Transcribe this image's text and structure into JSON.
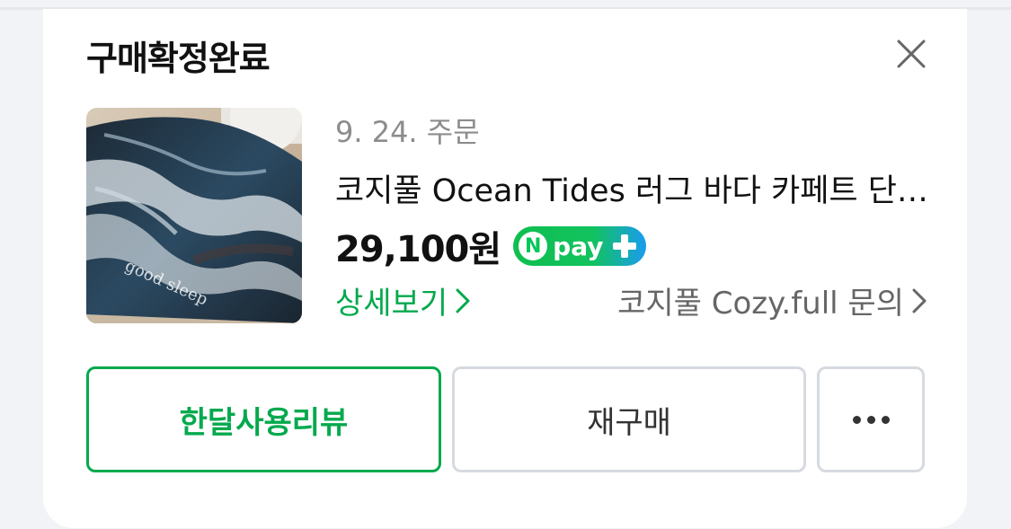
{
  "header": {
    "title": "구매확정완료"
  },
  "order": {
    "date_label": "9. 24. 주문",
    "product_name": "코지풀 Ocean Tides 러그 바다 카페트 단모 소형",
    "price": "29,100원",
    "npay": {
      "n_letter": "N",
      "text": "pay"
    },
    "detail_link": "상세보기",
    "inquiry_link": "코지풀 Cozy.full 문의",
    "thumbnail_caption": "good sleep"
  },
  "actions": {
    "review_label": "한달사용리뷰",
    "rebuy_label": "재구매"
  },
  "colors": {
    "accent_green": "#03a94d",
    "npay_green": "#03c75a",
    "npay_blue": "#1a9cf0",
    "border_gray": "#d6dae0"
  },
  "icons": {
    "close": "close-icon",
    "chevron": "chevron-right-icon",
    "more": "more-dots-icon",
    "plus": "plus-icon"
  }
}
